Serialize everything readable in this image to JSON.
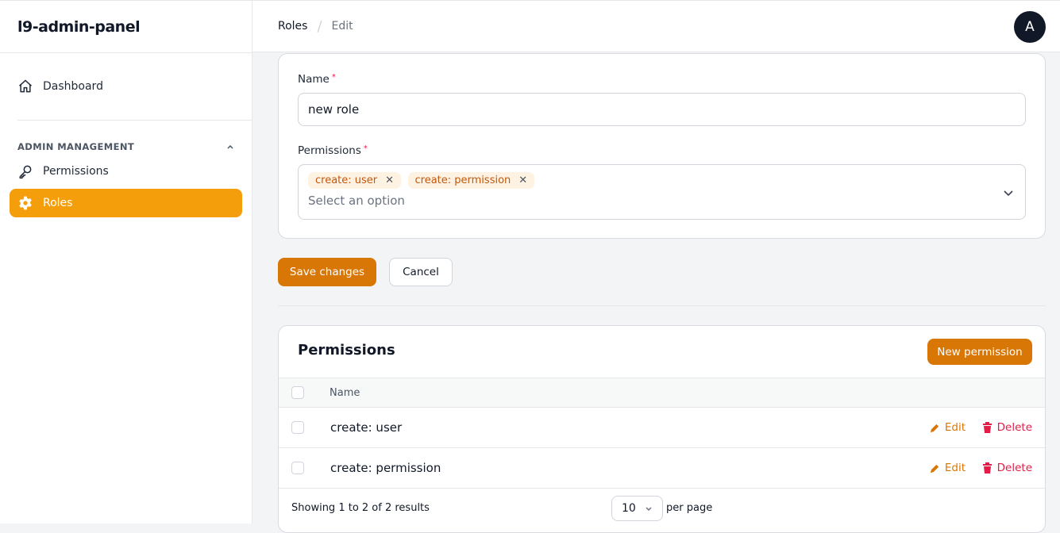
{
  "app": {
    "title": "l9-admin-panel"
  },
  "sidebar": {
    "dashboard": "Dashboard",
    "group": "ADMIN MANAGEMENT",
    "items": [
      {
        "label": "Permissions"
      },
      {
        "label": "Roles",
        "active": true
      }
    ]
  },
  "breadcrumb": {
    "items": [
      "Roles",
      "Edit"
    ]
  },
  "user": {
    "avatar_letter": "A"
  },
  "form": {
    "name_label": "Name",
    "name_value": "new role",
    "permissions_label": "Permissions",
    "required_mark": "*",
    "selected": [
      "create: user",
      "create: permission"
    ],
    "placeholder": "Select an option"
  },
  "actions": {
    "save": "Save changes",
    "cancel": "Cancel"
  },
  "permissions_table": {
    "title": "Permissions",
    "new_button": "New permission",
    "column_name": "Name",
    "rows": [
      {
        "name": "create: user",
        "edit": "Edit",
        "delete": "Delete"
      },
      {
        "name": "create: permission",
        "edit": "Edit",
        "delete": "Delete"
      }
    ],
    "summary": "Showing 1 to 2 of 2 results",
    "per_page_value": "10",
    "per_page_label": "per page"
  },
  "colors": {
    "accent": "#f59e0b",
    "primary_button": "#d97706",
    "danger": "#e11d48"
  }
}
